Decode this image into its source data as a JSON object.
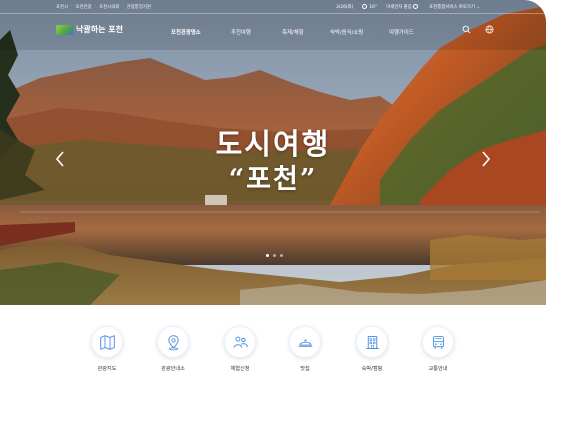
{
  "topbar": {
    "links": [
      "포천시",
      "포천관광",
      "포천시의회",
      "관광통일지원"
    ],
    "date": "3/26(화)",
    "weather": "16°",
    "air": "미세먼지 좋음",
    "site_menu": "포천통합서비스 바로가기"
  },
  "header": {
    "logo_text": "낙괄하는 포천",
    "nav": [
      "포천관광명소",
      "추천여행",
      "축제/체험",
      "숙박/음식/쇼핑",
      "여행가이드"
    ]
  },
  "hero": {
    "title_line1": "도시여행",
    "title_line2": "“포천”",
    "slide_count": 3,
    "active_slide": 1
  },
  "quick_menu": [
    {
      "label": "관광지도",
      "icon": "map-icon"
    },
    {
      "label": "관광안내소",
      "icon": "location-pin-icon"
    },
    {
      "label": "체험신청",
      "icon": "people-icon"
    },
    {
      "label": "맛집",
      "icon": "dish-cloche-icon"
    },
    {
      "label": "숙박/캠핑",
      "icon": "building-icon"
    },
    {
      "label": "교통안내",
      "icon": "bus-icon"
    }
  ],
  "colors": {
    "accent": "#3a82d6",
    "icon_blue": "#4a8ee0",
    "text": "#333333"
  }
}
